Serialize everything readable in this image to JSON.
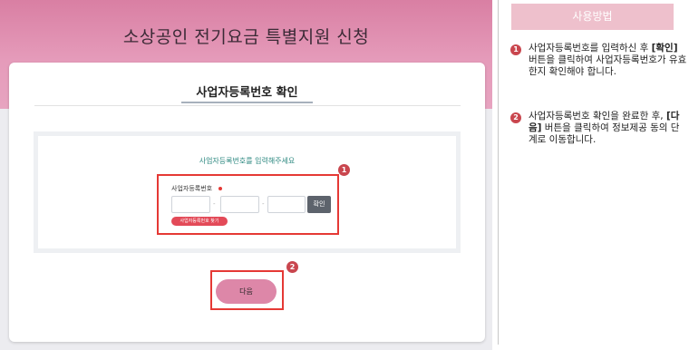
{
  "header": {
    "title": "소상공인 전기요금 특별지원 신청"
  },
  "card": {
    "title": "사업자등록번호 확인",
    "prompt": "사업자등록번호를 입력해주세요",
    "field_label": "사업자등록번호",
    "dash": "-",
    "confirm_label": "확인",
    "find_link": "사업자등록번호 찾기",
    "next_label": "다음"
  },
  "annotations": {
    "badge1": "1",
    "badge2": "2"
  },
  "help": {
    "header": "사용방법",
    "steps": [
      {
        "number": "1",
        "before": "사업자등록번호를 입력하신 후 ",
        "bold": "[확인]",
        "after": " 버튼을 클릭하여 사업자등록번호가 유효한지 확인해야 합니다."
      },
      {
        "number": "2",
        "before": "사업자등록번호 확인을 완료한 후, ",
        "bold": "[다음]",
        "after": " 버튼을 클릭하여 정보제공 동의 단계로 이동합니다."
      }
    ]
  },
  "colors": {
    "accent": "#dd87a8",
    "highlight": "#e53935",
    "badge": "#c9464e",
    "prompt": "#2f8a82"
  }
}
